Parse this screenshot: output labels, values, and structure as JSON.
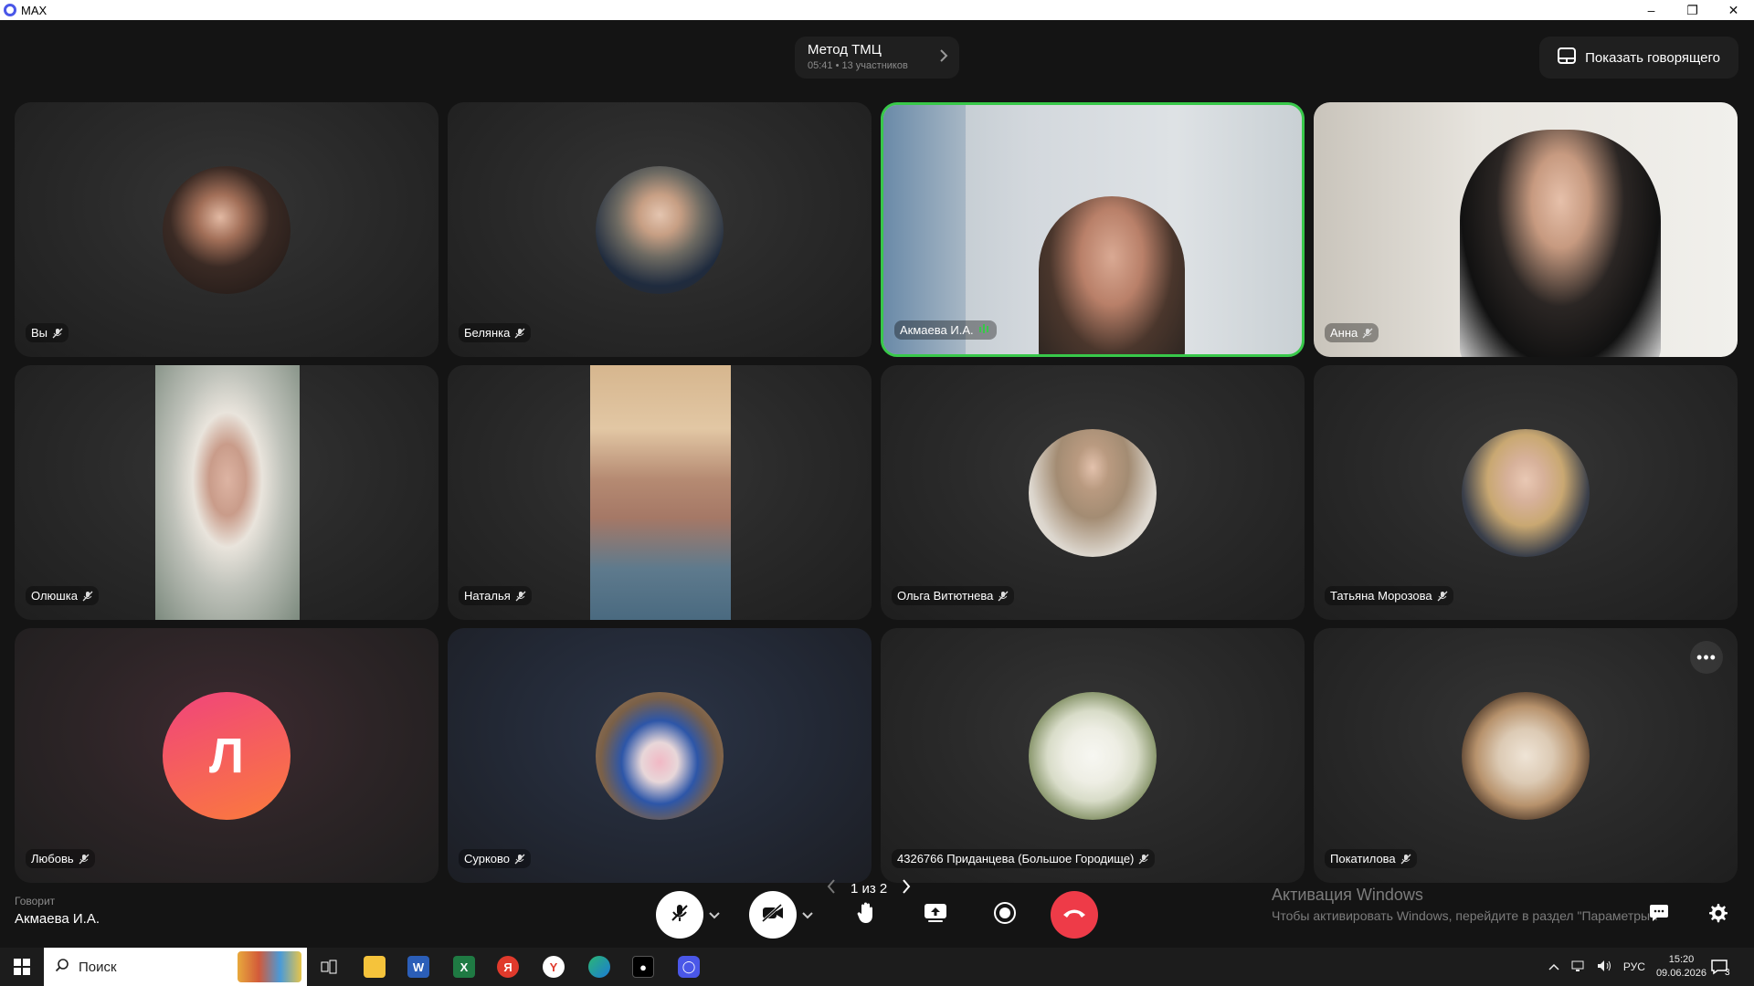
{
  "window": {
    "title": "MAX",
    "minimize": "–",
    "restore": "❐",
    "close": "✕"
  },
  "meeting": {
    "title": "Метод ТМЦ",
    "duration": "05:41",
    "separator": "•",
    "participants": "13 участников"
  },
  "show_speaker_label": "Показать говорящего",
  "tiles": [
    {
      "name": "Вы"
    },
    {
      "name": "Белянка"
    },
    {
      "name": "Акмаева И.А."
    },
    {
      "name": "Анна"
    },
    {
      "name": "Олюшка"
    },
    {
      "name": "Наталья"
    },
    {
      "name": "Ольга Витютнева"
    },
    {
      "name": "Татьяна Морозова"
    },
    {
      "name": "Любовь",
      "initial": "Л"
    },
    {
      "name": "Сурково"
    },
    {
      "name": "4326766 Приданцева (Большое Городище)"
    },
    {
      "name": "Покатилова"
    }
  ],
  "speaking": {
    "caption": "Говорит",
    "name": "Акмаева И.А."
  },
  "pager": {
    "label": "1 из 2"
  },
  "activation": {
    "title": "Активация Windows",
    "text": "Чтобы активировать Windows, перейдите в раздел \"Параметры\"."
  },
  "more_label": "•••",
  "taskbar": {
    "search_placeholder": "Поиск",
    "lang": "РУС",
    "time": "15:20",
    "date": "09.06.2026",
    "notif_count": "3"
  },
  "colors": {
    "active_speaker": "#38c84a",
    "end_call": "#ee3b48",
    "avatar_gradient_start": "#f0447c",
    "avatar_gradient_end": "#fb7b3c"
  }
}
